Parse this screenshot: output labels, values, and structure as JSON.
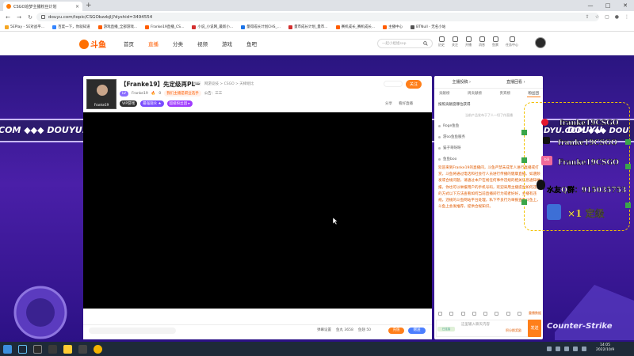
{
  "browser": {
    "tab_title": "CSGO追梦主播粉丝计划",
    "new_tab": "+",
    "url": "douyu.com/topic/CSGObzzbjlj?dyshid=3494554",
    "window_controls": [
      "—",
      "□",
      "✕"
    ],
    "bookmarks": [
      {
        "label": "5EPlay - 5E对战平...",
        "color": "#f5a623"
      },
      {
        "label": "百度一下，你就知道",
        "color": "#3385ff"
      },
      {
        "label": "游戏直播_全部游戏...",
        "color": "#ff5d00"
      },
      {
        "label": "Franke19直播_CS...",
        "color": "#ff5d00"
      },
      {
        "label": "小说_小说网_最新小...",
        "color": "#d32f2f"
      },
      {
        "label": "量得成长计划CHS_...",
        "color": "#1a73e8"
      },
      {
        "label": "量市成长计划_量市...",
        "color": "#d32f2f"
      },
      {
        "label": "赛机成长_赛机成长...",
        "color": "#ff5d00"
      },
      {
        "label": "主播中心",
        "color": "#ff5d00"
      },
      {
        "label": "BTNull - 无名小站",
        "color": "#555555"
      }
    ]
  },
  "site": {
    "logo": "斗鱼",
    "nav": [
      {
        "label": "首页",
        "active": false
      },
      {
        "label": "直播",
        "active": true
      },
      {
        "label": "分类",
        "active": false
      },
      {
        "label": "视频",
        "active": false
      },
      {
        "label": "游戏",
        "active": false
      },
      {
        "label": "鱼吧",
        "active": false
      }
    ],
    "search_placeholder": "一起小姐姐sop",
    "header_icons": [
      "历史",
      "关注",
      "开播",
      "消息",
      "鱼票",
      "任务中心"
    ]
  },
  "room": {
    "avatar_label": "Franke19",
    "title": "【Franke19】先定级再PL~",
    "tags": [
      "举报",
      "网游竞技 > CSGO > 天梯组比"
    ],
    "level_badge": "LV",
    "anchor_name": "Franke19",
    "hot": "0",
    "rank_badge": "我们主播是职业选手",
    "announcement": "公告：三三",
    "badges": [
      "VIP游戏",
      "最强观众 ★",
      "超级粉丝团 ▸"
    ],
    "follow": "关注",
    "share": "分享",
    "report": "看好直播"
  },
  "controls": {
    "items": [
      "弹幕设置",
      "鱼丸 3658",
      "鱼翅 50"
    ],
    "orange_btn": "充值",
    "blue_btn": "赠送"
  },
  "chat": {
    "top": [
      "主播投稿 ›",
      "直播回看 ›"
    ],
    "tabs": [
      {
        "label": "贡献榜",
        "active": false
      },
      {
        "label": "周贡献榜",
        "active": false
      },
      {
        "label": "贵宾榜",
        "active": false
      },
      {
        "label": "粉丝团",
        "active": true
      }
    ],
    "sub": "按照贡献度哪位获得",
    "banner": "当前产品发布于了人一切了作直播",
    "items": [
      "Roge鱼鱼",
      "游oo鱼鱼服务",
      "猫子哥呀呀",
      "鱼鱼boo"
    ],
    "notice": "欢迎来到Franke19的直播间，斗鱼严禁未成年人进行直播或打赏，斗鱼将通过电话和社会行人员进行传播的健康直播。如遇频发或合规问题，请通过本户在线任何事件违规的相关信息通知举报，你也可以举报用户的手机号码，欢迎采用主播提出如何违规的方式以下方法查看如何当前直播间行为或者好好，主播有违规，违规的斗鱼网站平台处理，私下不良行为举报查看斗鱼上，斗鱼上会发推荐，提供合规知识。",
    "tools_label": "重播数据",
    "input_placeholder": "这里输入聊天内容",
    "badge": "已连接",
    "hint": "积分换奖励",
    "send": "发送"
  },
  "overlay": {
    "line1": "franke19CSGO",
    "line2": "DYU.COM ◆◆◆ DOU",
    "line3": "franke19CSGO",
    "line4": "Franke19CSGO",
    "line5": "水友Q群：915035753",
    "line6": "×1 定级",
    "bili": "bili"
  },
  "background": {
    "band_left": "COM ◆◆◆ DOUYU.COM",
    "band_right": "DOUYU",
    "cs_text": "Counter-Strike"
  },
  "taskbar": {
    "time": "14:05",
    "date": "2022/10/9",
    "icons": [
      "windows",
      "steam",
      "app",
      "app2",
      "app3",
      "chrome"
    ]
  }
}
